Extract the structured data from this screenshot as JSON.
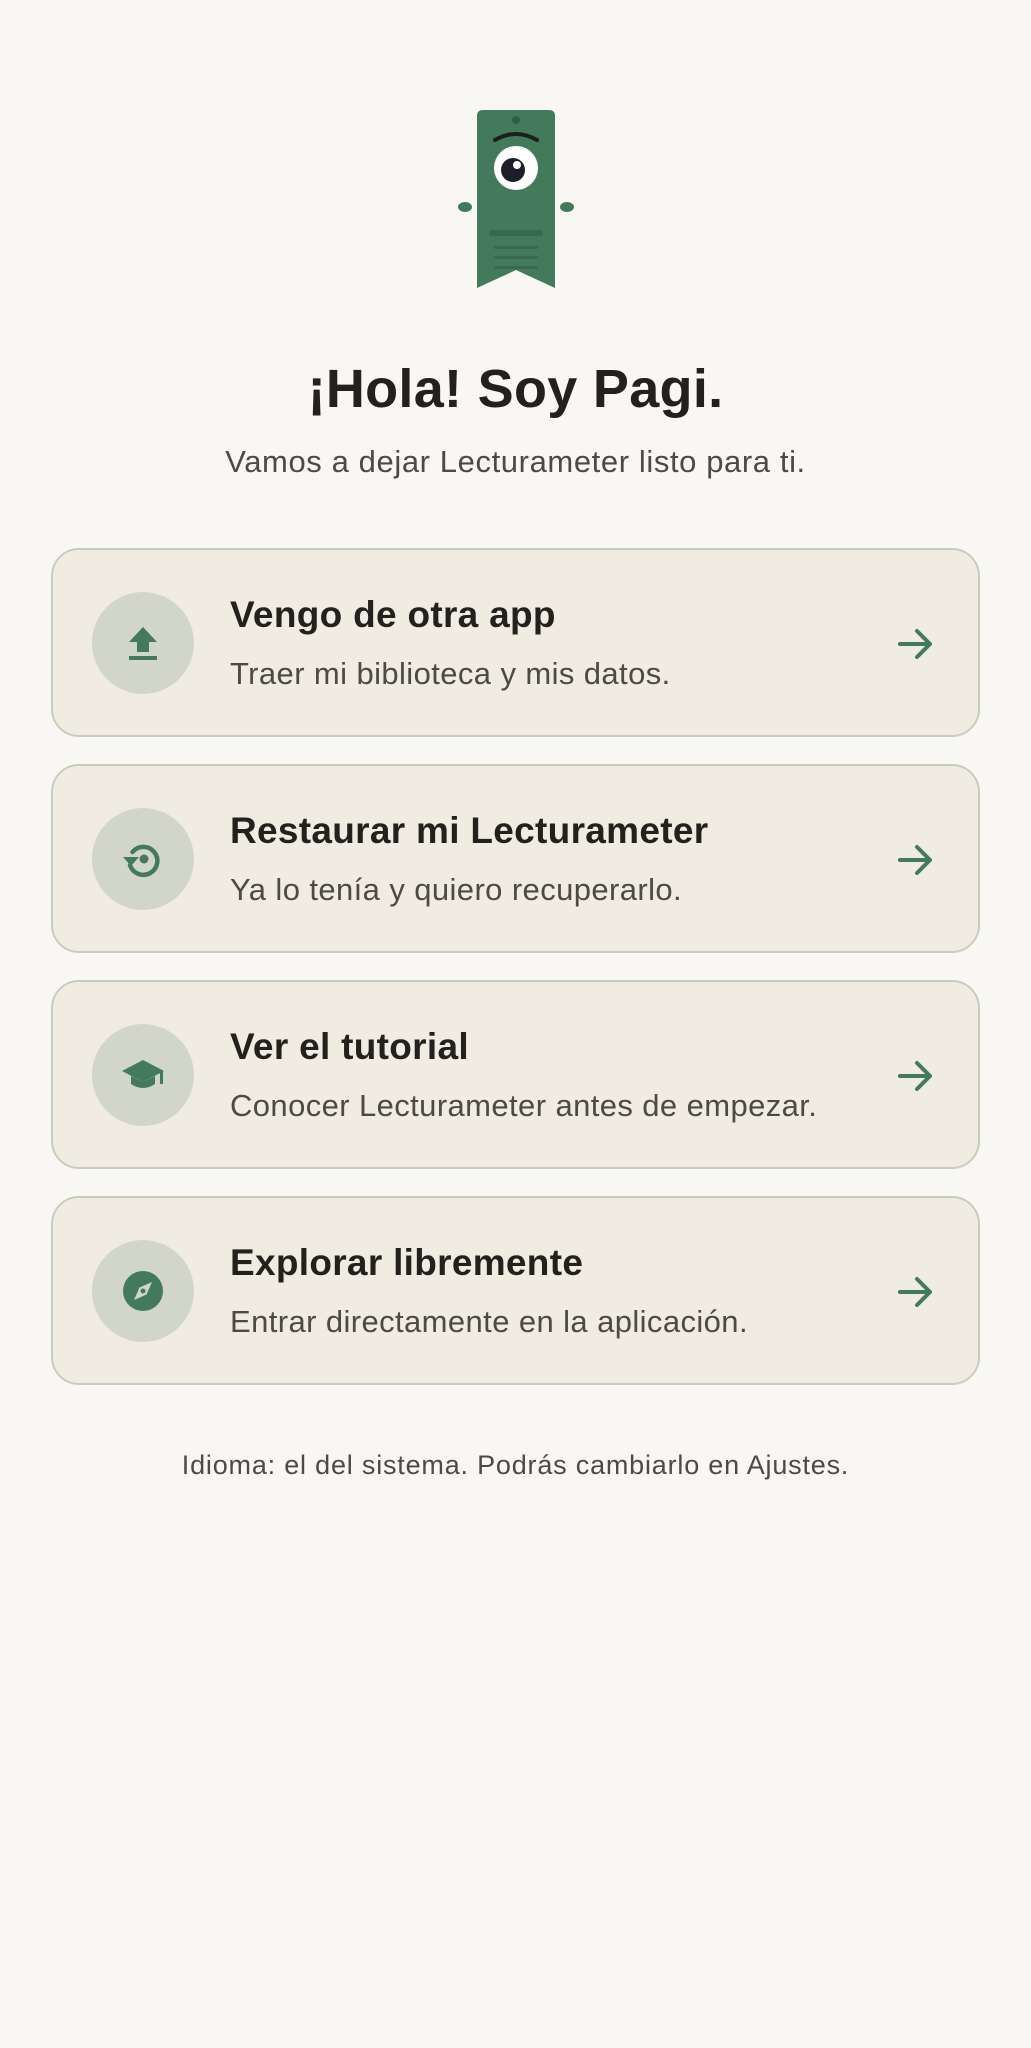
{
  "header": {
    "mascot_icon": "bookmark-mascot-icon",
    "title": "¡Hola! Soy Pagi.",
    "subtitle": "Vamos a dejar Lecturameter listo para ti."
  },
  "options": [
    {
      "title": "Vengo de otra app",
      "description": "Traer mi biblioteca y mis datos.",
      "icon": "upload-icon"
    },
    {
      "title": "Restaurar mi Lecturameter",
      "description": "Ya lo tenía y quiero recuperarlo.",
      "icon": "restore-icon"
    },
    {
      "title": "Ver el tutorial",
      "description": "Conocer Lecturameter antes de empezar.",
      "icon": "graduation-cap-icon"
    },
    {
      "title": "Explorar libremente",
      "description": "Entrar directamente en la aplicación.",
      "icon": "compass-icon"
    }
  ],
  "footer": {
    "language_note": "Idioma: el del sistema. Podrás cambiarlo en Ajustes."
  },
  "colors": {
    "background": "#f8f7f3",
    "card_background": "#f1ece2",
    "card_border": "#c7cdbe",
    "accent_green": "#427a5b",
    "icon_circle": "#d2d6ca",
    "text_primary": "#22211d",
    "text_secondary": "#4c4a45"
  }
}
